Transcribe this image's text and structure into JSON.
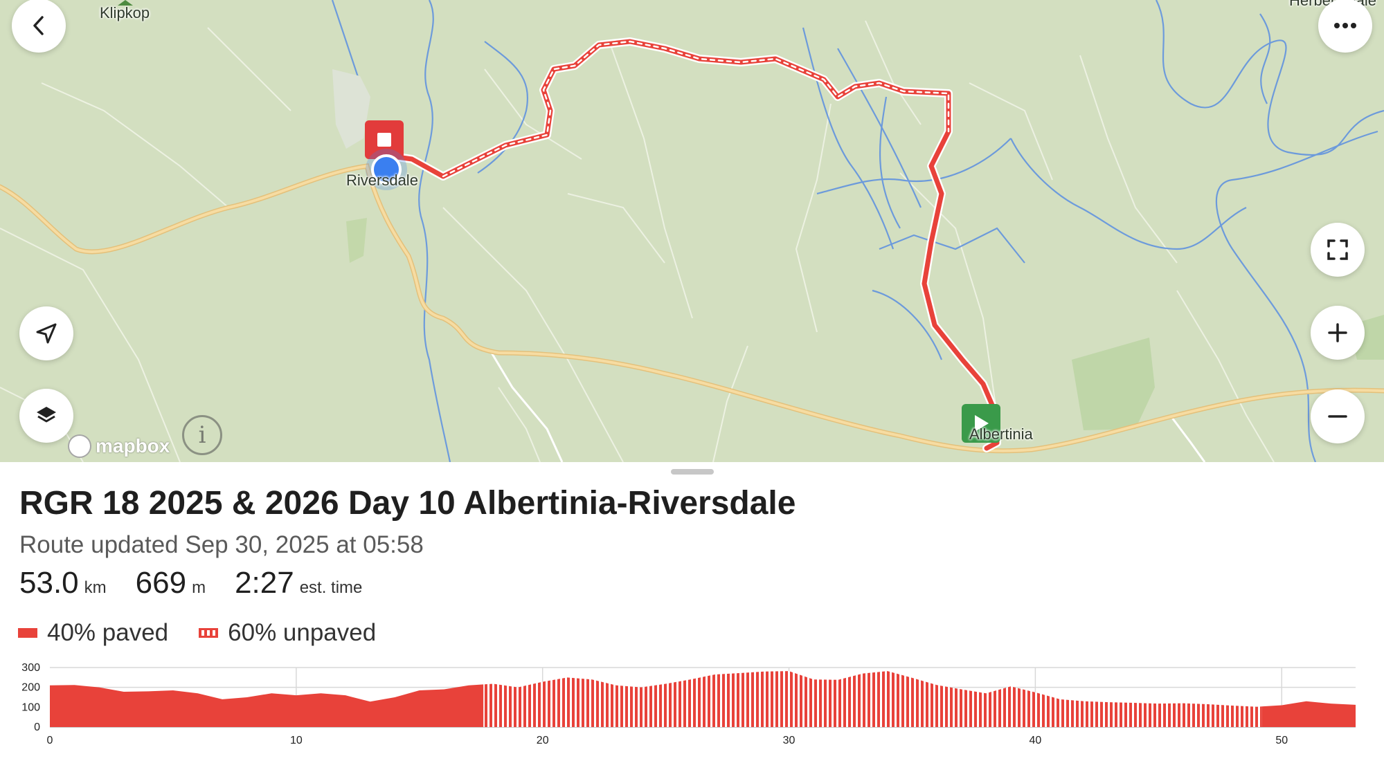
{
  "map": {
    "places": {
      "klipkop": "Klipkop",
      "riversdale": "Riversdale",
      "albertinia": "Albertinia",
      "herbertsdale": "Herbertsdale"
    },
    "attribution": "mapbox",
    "info_glyph": "i",
    "controls": [
      "back-icon",
      "more-icon",
      "fullscreen-icon",
      "zoom-in-icon",
      "zoom-out-icon",
      "locate-icon",
      "layers-icon"
    ],
    "colors": {
      "land": "#d3dfc0",
      "route": "#e8423a",
      "start_marker": "#3a9a4a",
      "end_marker": "#e23b3b",
      "user_location": "#3a7ff0",
      "water": "#5b8fe0",
      "main_road": "#f2cf86"
    }
  },
  "route": {
    "title": "RGR 18 2025 & 2026 Day 10 Albertinia-Riversdale",
    "updated": "Route updated Sep 30, 2025 at 05:58",
    "stats": [
      {
        "value": "53.0",
        "unit": "km"
      },
      {
        "value": "669",
        "unit": "m"
      },
      {
        "value": "2:27",
        "unit": "est. time"
      }
    ],
    "surface": [
      {
        "type": "paved",
        "label": "40% paved"
      },
      {
        "type": "unpaved",
        "label": "60% unpaved"
      }
    ]
  },
  "chart_data": {
    "type": "area",
    "xlabel": "",
    "ylabel": "",
    "xlim": [
      0,
      53
    ],
    "ylim": [
      0,
      300
    ],
    "xticks": [
      0,
      10,
      20,
      30,
      40,
      50
    ],
    "yticks": [
      0,
      100,
      200,
      300
    ],
    "grid": true,
    "segments": [
      {
        "from": 0,
        "to": 17.6,
        "surface": "paved"
      },
      {
        "from": 17.6,
        "to": 49.2,
        "surface": "unpaved"
      },
      {
        "from": 49.2,
        "to": 53.0,
        "surface": "paved"
      }
    ],
    "elevation": [
      [
        0,
        210
      ],
      [
        1,
        212
      ],
      [
        2,
        200
      ],
      [
        3,
        178
      ],
      [
        4,
        180
      ],
      [
        5,
        185
      ],
      [
        6,
        170
      ],
      [
        7,
        140
      ],
      [
        8,
        150
      ],
      [
        9,
        170
      ],
      [
        10,
        160
      ],
      [
        11,
        170
      ],
      [
        12,
        160
      ],
      [
        13,
        128
      ],
      [
        14,
        150
      ],
      [
        15,
        185
      ],
      [
        16,
        190
      ],
      [
        17,
        210
      ],
      [
        18,
        218
      ],
      [
        19,
        200
      ],
      [
        20,
        228
      ],
      [
        21,
        250
      ],
      [
        22,
        240
      ],
      [
        23,
        210
      ],
      [
        24,
        200
      ],
      [
        25,
        218
      ],
      [
        26,
        240
      ],
      [
        27,
        265
      ],
      [
        28,
        272
      ],
      [
        29,
        280
      ],
      [
        30,
        282
      ],
      [
        31,
        240
      ],
      [
        32,
        238
      ],
      [
        33,
        270
      ],
      [
        34,
        282
      ],
      [
        35,
        248
      ],
      [
        36,
        212
      ],
      [
        37,
        190
      ],
      [
        38,
        170
      ],
      [
        39,
        205
      ],
      [
        40,
        175
      ],
      [
        41,
        140
      ],
      [
        42,
        130
      ],
      [
        43,
        125
      ],
      [
        44,
        122
      ],
      [
        45,
        118
      ],
      [
        46,
        120
      ],
      [
        47,
        115
      ],
      [
        48,
        108
      ],
      [
        49,
        102
      ],
      [
        50,
        110
      ],
      [
        51,
        130
      ],
      [
        52,
        118
      ],
      [
        53,
        112
      ]
    ]
  }
}
